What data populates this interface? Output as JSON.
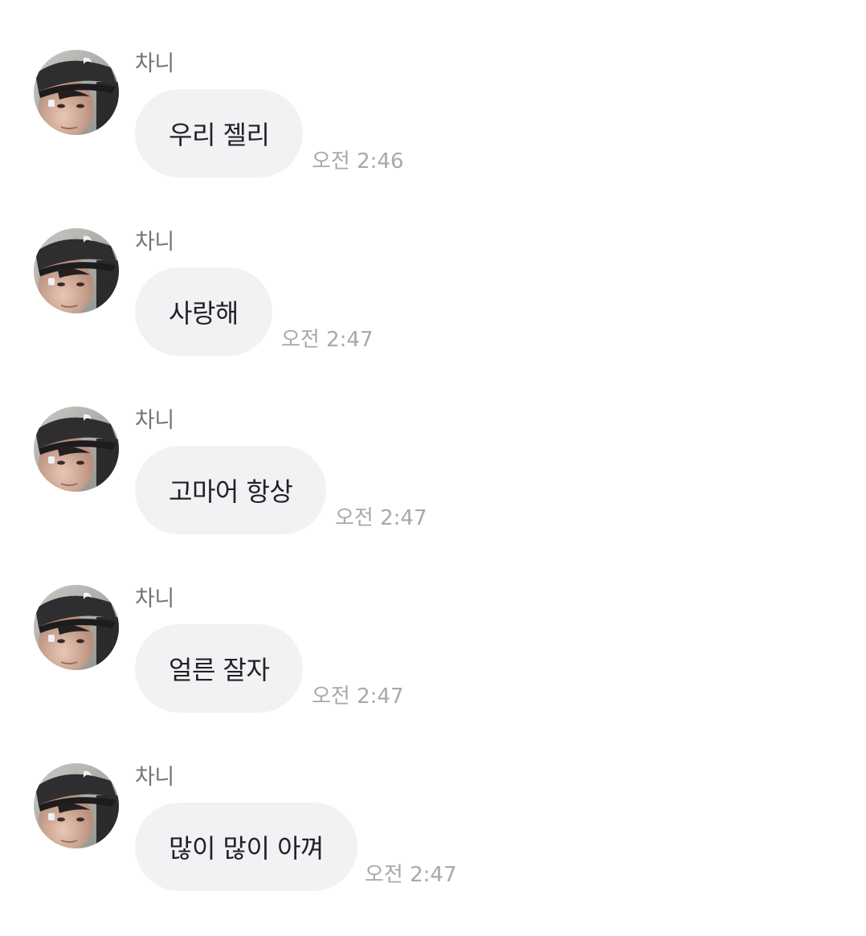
{
  "messages": [
    {
      "sender": "차니",
      "text": "우리 젤리",
      "time": "오전 2:46"
    },
    {
      "sender": "차니",
      "text": "사랑해",
      "time": "오전 2:47"
    },
    {
      "sender": "차니",
      "text": "고마어 항상",
      "time": "오전 2:47"
    },
    {
      "sender": "차니",
      "text": "얼른 잘자",
      "time": "오전 2:47"
    },
    {
      "sender": "차니",
      "text": "많이 많이 아껴",
      "time": "오전 2:47"
    }
  ],
  "colors": {
    "background": "#ffffff",
    "bubble": "#f2f2f4",
    "bubble_text": "#222226",
    "sender_text": "#737378",
    "time_text": "#a8a8ad"
  },
  "icons": {
    "avatar": "profile-photo"
  }
}
